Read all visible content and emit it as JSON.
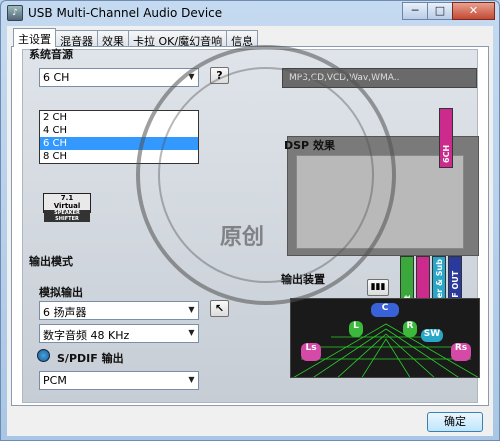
{
  "window": {
    "title": "USB Multi-Channel Audio Device",
    "controls": [
      "─",
      "□",
      "✕"
    ]
  },
  "tabs": [
    "主设置",
    "混音器",
    "效果",
    "卡拉 OK/魔幻音响",
    "信息"
  ],
  "system_source": {
    "label": "系统音源",
    "selected": "6 CH",
    "options": [
      "2 CH",
      "4 CH",
      "6 CH",
      "8 CH"
    ],
    "selected_option_index": 2,
    "help_button": "?",
    "format_text": "MP3,CD,VCD,Wav,WMA.."
  },
  "dsp": {
    "label": "DSP 效果"
  },
  "virtual_badge": {
    "line1": "7.1",
    "line2": "Virtual",
    "line3": "SPEAKER SHIFTER"
  },
  "channel_bars": {
    "top": "6CH",
    "bars": [
      "Front",
      "Side Surround",
      "Center & Sub",
      "SPDIF OUT"
    ],
    "colors": [
      "#3aa83a",
      "#cc2a8c",
      "#2aa6c8",
      "#2a3a9c"
    ]
  },
  "output_mode": {
    "label": "输出模式",
    "analog_label": "模拟输出",
    "speakers_selected": "6 扬声器",
    "digital_freq": "数字音频 48 KHz",
    "spdif_label": "S/PDIF 输出",
    "spdif_mode": "PCM"
  },
  "output_device": {
    "label": "输出装置",
    "speakers": [
      "C",
      "L",
      "R",
      "SW",
      "Ls",
      "Rs"
    ]
  },
  "ok_button": "确定",
  "watermark": {
    "text": "原创"
  }
}
